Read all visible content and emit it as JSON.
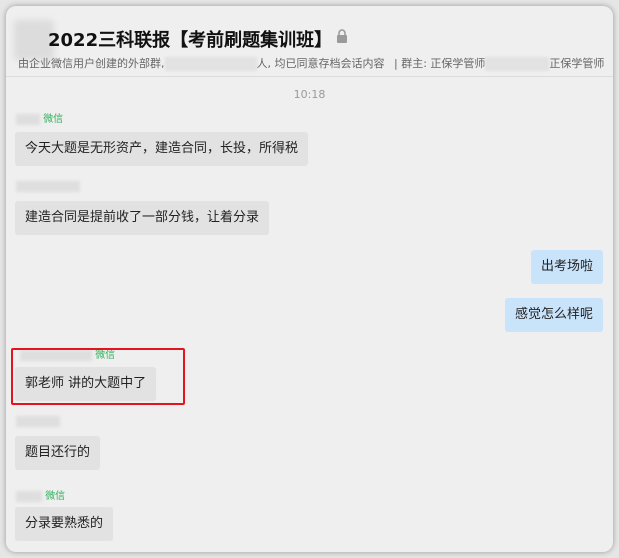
{
  "header": {
    "title": "2022三科联报【考前刷题集训班】",
    "subtitle_part1": "由企业微信用户创建的外部群,",
    "subtitle_part2": "人, 均已同意存档会话内容",
    "subtitle_part3": "| 群主: 正保学管师",
    "subtitle_part4": "正保学管师"
  },
  "chat": {
    "timestamp": "10:18",
    "wechat_suffix": "微信",
    "messages": [
      {
        "side": "in",
        "text": "今天大题是无形资产，建造合同，长投，所得税"
      },
      {
        "side": "in",
        "text": "建造合同是提前收了一部分钱，让着分录"
      },
      {
        "side": "out",
        "text": "出考场啦"
      },
      {
        "side": "out",
        "text": "感觉怎么样呢"
      },
      {
        "side": "in",
        "text": "郭老师 讲的大题中了"
      },
      {
        "side": "in",
        "text": "题目还行的"
      },
      {
        "side": "in",
        "text": "分录要熟悉的"
      }
    ]
  },
  "colors": {
    "highlight": "#e5141c",
    "incoming_bubble": "#e2e2e2",
    "outgoing_bubble": "#c9e3fb",
    "wechat_green": "#2fb15c"
  }
}
